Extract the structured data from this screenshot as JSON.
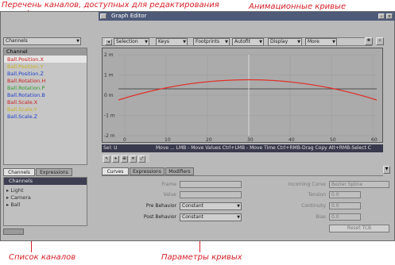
{
  "annotations": {
    "channels_editable": "Перечень каналов, доступных для редактирования",
    "animation_curves": "Анимационные кривые",
    "channel_list": "Список каналов",
    "curve_params": "Параметры кривых"
  },
  "window": {
    "title": "Graph Editor"
  },
  "left": {
    "channels_dropdown": "Channels",
    "channels_header": "Channel",
    "channels": [
      {
        "label": "Ball.Position.X",
        "color": "#c82020"
      },
      {
        "label": "Ball.Position.Y",
        "color": "#c8b020"
      },
      {
        "label": "Ball.Position.Z",
        "color": "#2040c8"
      },
      {
        "label": "Ball.Rotation.H",
        "color": "#c82020"
      },
      {
        "label": "Ball.Rotation.P",
        "color": "#2f9a2f"
      },
      {
        "label": "Ball.Rotation.B",
        "color": "#2040c8"
      },
      {
        "label": "Ball.Scale.X",
        "color": "#c82020"
      },
      {
        "label": "Ball.Scale.Y",
        "color": "#c8b020"
      },
      {
        "label": "Ball.Scale.Z",
        "color": "#2040c8"
      }
    ],
    "tabs": [
      "Channels",
      "Expressions"
    ],
    "tree_header": "Channels",
    "tree": [
      "Light",
      "Camera",
      "Ball"
    ]
  },
  "toolbar": {
    "selection": "Selection",
    "keys": "Keys",
    "footprints": "Footprints",
    "autofit": "Autofit",
    "display": "Display",
    "more": "More"
  },
  "graph": {
    "y_ticks": [
      "2 m",
      "1 m",
      "0 m",
      "-1 m",
      "-2 m"
    ],
    "x_ticks": [
      "0",
      "10",
      "20",
      "30",
      "40",
      "50",
      "60"
    ],
    "current_frame": "30"
  },
  "status": {
    "sel": "Sel: U",
    "hint": "Move ... LMB - Move Values  Ctrl+LMB - Move Time  Ctrl+RMB-Drag Copy  Alt+RMB-Select C"
  },
  "bottom": {
    "tabs": [
      "Curves",
      "Expressions",
      "Modifiers"
    ],
    "frame_label": "Frame",
    "value_label": "Value",
    "pre_behavior_label": "Pre Behavior",
    "pre_behavior_value": "Constant",
    "post_behavior_label": "Post Behavior",
    "post_behavior_value": "Constant",
    "incoming_curve_label": "Incoming Curve",
    "incoming_curve_value": "Bezier Spline",
    "tension_label": "Tension",
    "tension_value": "0.0",
    "continuity_label": "Continuity",
    "continuity_value": "0.0",
    "bias_label": "Bias",
    "bias_value": "0.0",
    "reset_button": "Reset TCB"
  },
  "colors": {
    "curve": "#e0302a",
    "accent_annotation": "#d6202a"
  }
}
